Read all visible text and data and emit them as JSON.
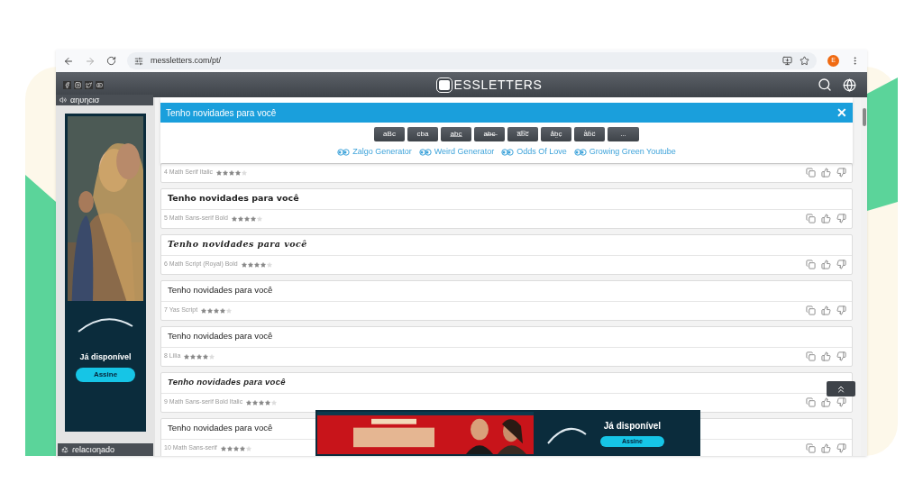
{
  "browser": {
    "url": "messletters.com/pt/",
    "profile_initial": "E"
  },
  "header": {
    "logo": "ESSLETTERS"
  },
  "sidebar": {
    "ad_label": "αηυηcισ",
    "ad": {
      "tagline": "Já disponível",
      "cta": "Assine"
    },
    "related_label": "ɾelacıoηado"
  },
  "banner": {
    "text": "Tenho novidades para você",
    "close": "✕"
  },
  "style_buttons": [
    "aBc",
    "cba",
    "a̲b̲c̲",
    "a̶b̶c̶",
    "a̅b̅c̅",
    "a̽b̤c̣",
    "ä̍b̈c̈",
    "..."
  ],
  "links": [
    "Zalgo Generator",
    "Weird Generator",
    "Odds Of Love",
    "Growing Green Youtube"
  ],
  "results": [
    {
      "meta": "4 Math Serif Italic",
      "stars": 4
    },
    {
      "text": "Tenho novidades para você",
      "kind": "bold",
      "meta": "5 Math Sans-serif Bold",
      "stars": 4
    },
    {
      "text": "Tenho novidades para você",
      "kind": "script",
      "meta": "6 Math Script (Royal) Bold",
      "stars": 4
    },
    {
      "text": "Tenho novidades para você",
      "kind": "regular",
      "meta": "7 Yas Script",
      "stars": 4
    },
    {
      "text": "Tenho novidades para você",
      "kind": "regular",
      "meta": "8 Lilia",
      "stars": 4
    },
    {
      "text": "Tenho novidades para você",
      "kind": "bold-italic",
      "meta": "9 Math Sans-serif Bold Italic",
      "stars": 4
    },
    {
      "text": "Tenho novidades para você",
      "kind": "regular",
      "meta": "10 Math Sans-serif",
      "stars": 4
    }
  ],
  "bottom_ad": {
    "tagline": "Já disponível",
    "cta": "Assine"
  }
}
